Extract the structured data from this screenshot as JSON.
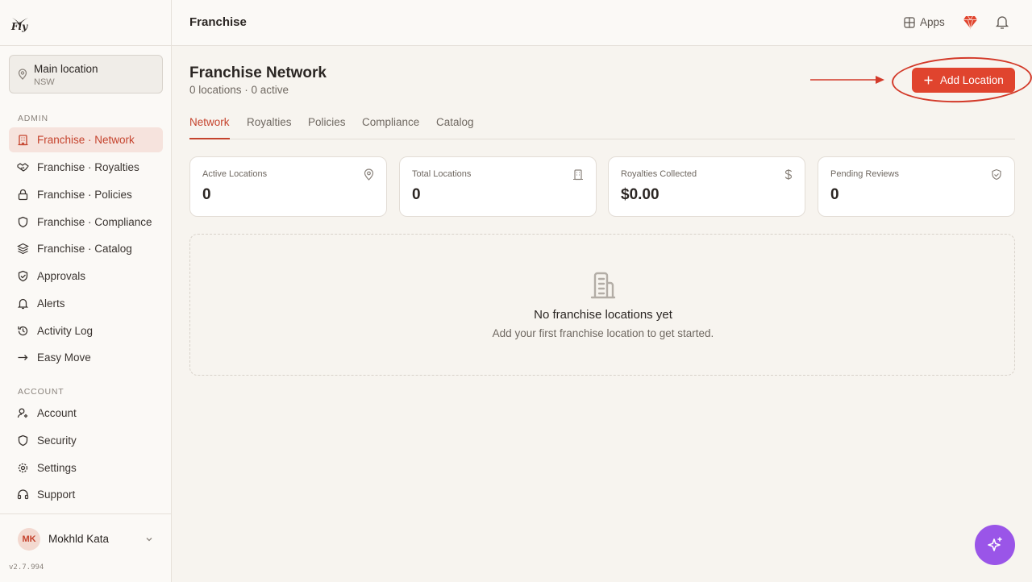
{
  "brand": {
    "logo_text": "Fly"
  },
  "header": {
    "title": "Franchise",
    "apps_label": "Apps"
  },
  "location": {
    "name": "Main location",
    "region": "NSW"
  },
  "sidebar": {
    "admin_label": "ADMIN",
    "admin_items": [
      {
        "label": "Franchise · Network",
        "icon": "building-icon",
        "active": true
      },
      {
        "label": "Franchise · Royalties",
        "icon": "handshake-icon"
      },
      {
        "label": "Franchise · Policies",
        "icon": "lock-icon"
      },
      {
        "label": "Franchise · Compliance",
        "icon": "shield-icon"
      },
      {
        "label": "Franchise · Catalog",
        "icon": "layers-icon"
      },
      {
        "label": "Approvals",
        "icon": "shield-check-icon"
      },
      {
        "label": "Alerts",
        "icon": "bell-icon"
      },
      {
        "label": "Activity Log",
        "icon": "history-icon"
      },
      {
        "label": "Easy Move",
        "icon": "arrow-right-icon"
      }
    ],
    "account_label": "ACCOUNT",
    "account_items": [
      {
        "label": "Account",
        "icon": "user-cog-icon"
      },
      {
        "label": "Security",
        "icon": "shield-icon"
      },
      {
        "label": "Settings",
        "icon": "gear-icon"
      },
      {
        "label": "Support",
        "icon": "headset-icon"
      }
    ]
  },
  "user": {
    "initials": "MK",
    "name": "Mokhld Kata"
  },
  "version": "v2.7.994",
  "page": {
    "title": "Franchise Network",
    "subtitle": "0 locations · 0 active",
    "add_button": "Add Location"
  },
  "tabs": [
    {
      "label": "Network",
      "active": true
    },
    {
      "label": "Royalties"
    },
    {
      "label": "Policies"
    },
    {
      "label": "Compliance"
    },
    {
      "label": "Catalog"
    }
  ],
  "stats": [
    {
      "label": "Active Locations",
      "value": "0",
      "icon": "map-pin-icon"
    },
    {
      "label": "Total Locations",
      "value": "0",
      "icon": "building-icon"
    },
    {
      "label": "Royalties Collected",
      "value": "$0.00",
      "icon": "dollar-icon"
    },
    {
      "label": "Pending Reviews",
      "value": "0",
      "icon": "shield-check-icon"
    }
  ],
  "empty_state": {
    "title": "No franchise locations yet",
    "subtitle": "Add your first franchise location to get started."
  },
  "colors": {
    "accent": "#e0442e",
    "accent_text": "#c5432d",
    "fab": "#9a55e8",
    "annotation": "#d33a2a"
  }
}
